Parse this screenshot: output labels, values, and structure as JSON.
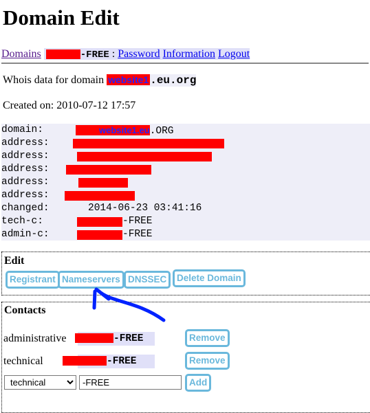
{
  "title": "Domain Edit",
  "nav": {
    "domains": "Domains",
    "handle_suffix": "-FREE",
    "sep": ":",
    "password": "Password",
    "information": "Information",
    "logout": "Logout"
  },
  "whois": {
    "prefix": "Whois data for domain ",
    "domain_redacted": "website1",
    "domain_suffix": ".eu.org"
  },
  "created": "Created on: 2010-07-12 17:57",
  "record": {
    "domain_label": "domain:",
    "domain_redacted": "website1.eu",
    "domain_suffix": ".ORG",
    "address_label": "address:",
    "changed_label": "changed:",
    "changed_value": "2014-06-23 03:41:16",
    "techc_label": "tech-c:",
    "techc_suffix": "-FREE",
    "adminc_label": "admin-c:",
    "adminc_suffix": "-FREE"
  },
  "edit": {
    "heading": "Edit",
    "buttons": [
      "Registrant",
      "Nameservers",
      "DNSSEC",
      "Delete Domain"
    ]
  },
  "contacts": {
    "heading": "Contacts",
    "rows": [
      {
        "role": "administrative",
        "suffix": "-FREE",
        "button": "Remove"
      },
      {
        "role": "technical",
        "suffix": "-FREE",
        "button": "Remove"
      }
    ],
    "add": {
      "select_value": "technical",
      "input_value": "-FREE",
      "button": "Add"
    }
  },
  "colors": {
    "button": "#6ab8dc",
    "highlight": "#e0e0f8",
    "redaction": "#ff0000",
    "annotation_arrow": "#0022ff"
  }
}
